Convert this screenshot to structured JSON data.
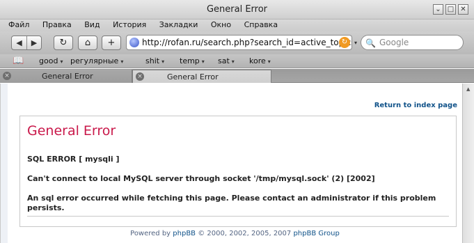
{
  "window": {
    "title": "General Error"
  },
  "window_buttons": [
    "⌄",
    "□",
    "✕"
  ],
  "menu": [
    "Файл",
    "Правка",
    "Вид",
    "История",
    "Закладки",
    "Окно",
    "Справка"
  ],
  "nav": {
    "back": "◀",
    "forward": "▶",
    "reload": "↻",
    "home": "⌂",
    "add": "+",
    "url": "http://rofan.ru/search.php?search_id=active_topics",
    "reload_badge": "↻",
    "url_dropdown": "▾",
    "search_placeholder": "Google",
    "search_icon": "🔍"
  },
  "bookmarks": {
    "book_icon": "📖",
    "items": [
      "good",
      "регулярные",
      "shit",
      "temp",
      "sat",
      "kore"
    ],
    "dropdown_icon": "▾"
  },
  "tabs": [
    {
      "label": "General Error",
      "close": "×"
    },
    {
      "label": "General Error",
      "close": "×"
    }
  ],
  "content": {
    "return_link": "Return to index page",
    "title": "General Error",
    "sql_error": "SQL ERROR [ mysqli ]",
    "connect_msg": "Can't connect to local MySQL server through socket '/tmp/mysql.sock' (2) [2002]",
    "error_msg": "An sql error occurred while fetching this page. Please contact an administrator if this problem persists.",
    "footer_prefix": "Powered by ",
    "footer_link": "phpBB",
    "footer_middle": " © 2000, 2002, 2005, 2007 ",
    "footer_suffix": "phpBB Group"
  },
  "scroll_arrow": "▲",
  "colors": {
    "error_title": "#c9184a",
    "link": "#105289"
  }
}
